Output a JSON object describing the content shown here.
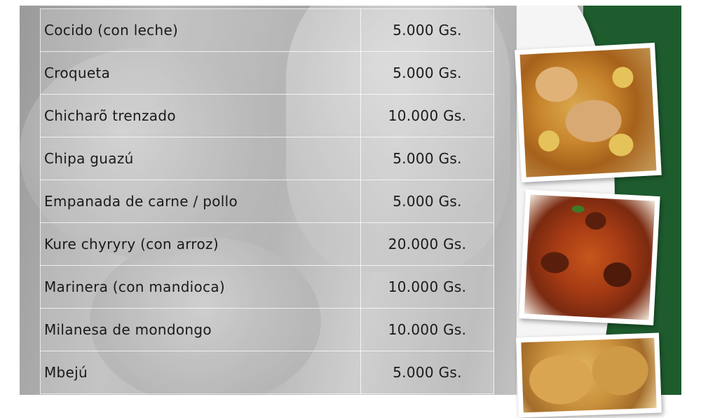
{
  "menu": {
    "items": [
      {
        "name": "Cocido (con leche)",
        "price": "5.000 Gs."
      },
      {
        "name": "Croqueta",
        "price": "5.000 Gs."
      },
      {
        "name": "Chicharõ trenzado",
        "price": "10.000 Gs."
      },
      {
        "name": "Chipa guazú",
        "price": "5.000 Gs."
      },
      {
        "name": "Empanada de carne / pollo",
        "price": "5.000 Gs."
      },
      {
        "name": "Kure chyryry (con arroz)",
        "price": "20.000 Gs."
      },
      {
        "name": "Marinera (con mandioca)",
        "price": "10.000 Gs."
      },
      {
        "name": "Milanesa de mondongo",
        "price": "10.000 Gs."
      },
      {
        "name": "Mbejú",
        "price": "5.000 Gs."
      }
    ]
  },
  "theme": {
    "accent_green": "#1e5c2e",
    "background_gray": "#b5b5b5"
  },
  "photos": [
    "chicken-stew-photo",
    "spaghetti-meat-sauce-photo",
    "fried-empanadas-photo"
  ]
}
